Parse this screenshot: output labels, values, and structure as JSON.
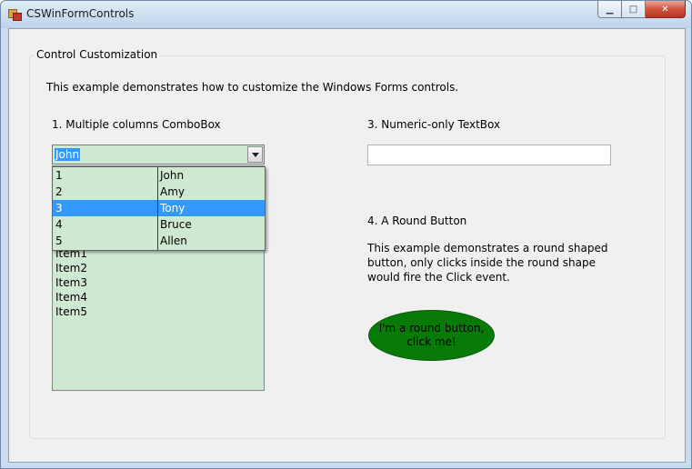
{
  "window": {
    "title": "CSWinFormControls",
    "minimize_glyph": "▁",
    "maximize_glyph": "□",
    "close_glyph": "✕"
  },
  "group": {
    "title": "Control Customization",
    "intro": "This example demonstrates how to customize the Windows Forms controls."
  },
  "combo_section": {
    "label": "1. Multiple columns ComboBox",
    "selected_text": "John",
    "dropdown_rows": [
      {
        "id": "1",
        "name": "John",
        "selected": false
      },
      {
        "id": "2",
        "name": "Amy",
        "selected": false
      },
      {
        "id": "3",
        "name": "Tony",
        "selected": true
      },
      {
        "id": "4",
        "name": "Bruce",
        "selected": false
      },
      {
        "id": "5",
        "name": "Allen",
        "selected": false
      }
    ],
    "list_items": [
      "Item1",
      "Item2",
      "Item3",
      "Item4",
      "Item5"
    ]
  },
  "numeric_section": {
    "label": "3. Numeric-only TextBox",
    "value": ""
  },
  "round_section": {
    "label": "4. A Round Button",
    "description": "This example demonstrates a round shaped button, only clicks inside the round shape would fire the Click event.",
    "button_label": "I'm a round button, click me!"
  },
  "colors": {
    "control_bg": "#cfe8d2",
    "selection": "#3399ff",
    "round_button": "#077a07"
  }
}
